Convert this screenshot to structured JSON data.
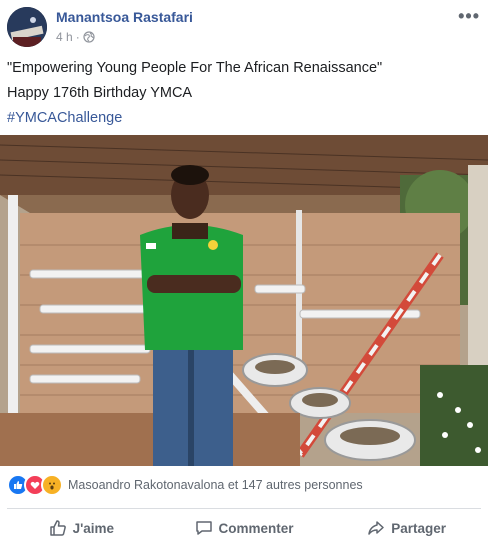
{
  "post": {
    "author": "Manantsoa Rastafari",
    "time": "4 h",
    "separator": "·",
    "lines": [
      "\"Empowering Young People For The African Renaissance\"",
      "Happy 176th Birthday YMCA"
    ],
    "hashtag": "#YMCAChallenge"
  },
  "reactions": {
    "icons": [
      "like-icon",
      "love-icon",
      "wow-icon"
    ],
    "summary": "Masoandro Rakotonavalona et 147 autres personnes"
  },
  "actions": {
    "like": "J'aime",
    "comment": "Commenter",
    "share": "Partager"
  },
  "colors": {
    "link": "#385898",
    "like": "#1877f2",
    "love": "#f33e58",
    "wow": "#f7b125",
    "shirt": "#1fa33c"
  }
}
